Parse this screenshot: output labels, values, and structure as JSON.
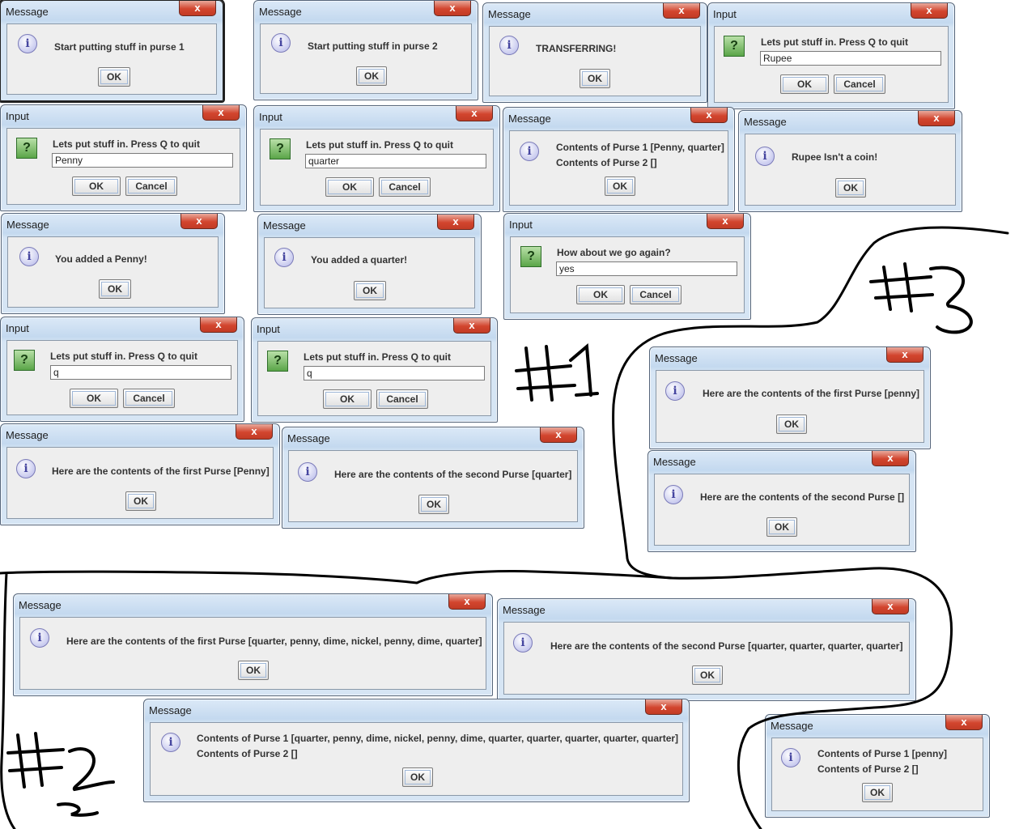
{
  "titles": {
    "message": "Message",
    "input": "Input"
  },
  "buttons": {
    "ok": "OK",
    "cancel": "Cancel"
  },
  "icons": {
    "info": "i",
    "question": "?",
    "close": "x"
  },
  "dialogs": {
    "d1": {
      "text": "Start putting stuff in purse 1"
    },
    "d2": {
      "text": "Start putting stuff in purse 2"
    },
    "d3": {
      "text": "TRANSFERRING!"
    },
    "d4": {
      "text": "Lets put stuff in. Press Q to quit",
      "value": "Rupee"
    },
    "d5": {
      "text": "Lets put stuff in. Press Q to quit",
      "value": "Penny"
    },
    "d6": {
      "text": "Lets put stuff in. Press Q to quit",
      "value": "quarter"
    },
    "d7": {
      "line1": "Contents of Purse 1 [Penny, quarter]",
      "line2": "Contents of Purse 2 []"
    },
    "d8": {
      "text": "Rupee Isn't a coin!"
    },
    "d9": {
      "text": "You added a Penny!"
    },
    "d10": {
      "text": "You added a quarter!"
    },
    "d11": {
      "text": "How about we go again?",
      "value": "yes"
    },
    "d12": {
      "text": "Lets put stuff in. Press Q to quit",
      "value": "q"
    },
    "d13": {
      "text": "Lets put stuff in. Press Q to quit",
      "value": "q"
    },
    "d14": {
      "text": "Here are the contents of the first Purse [penny]"
    },
    "d15": {
      "text": "Here are the contents of the first Purse [Penny]"
    },
    "d16": {
      "text": "Here are the contents of the second Purse [quarter]"
    },
    "d17": {
      "text": "Here are the contents of the second Purse []"
    },
    "d18": {
      "text": "Here are the contents of the first Purse [quarter, penny, dime, nickel, penny, dime, quarter]"
    },
    "d19": {
      "text": "Here are the contents of the second Purse [quarter, quarter, quarter, quarter]"
    },
    "d20": {
      "line1": "Contents of Purse 1 [quarter, penny, dime, nickel, penny, dime, quarter, quarter, quarter, quarter, quarter]",
      "line2": "Contents of Purse 2 []"
    },
    "d21": {
      "line1": "Contents of Purse 1 [penny]",
      "line2": "Contents of Purse 2 []"
    }
  },
  "annotations": {
    "n1": "#1",
    "n2": "#2",
    "n3": "#3"
  }
}
